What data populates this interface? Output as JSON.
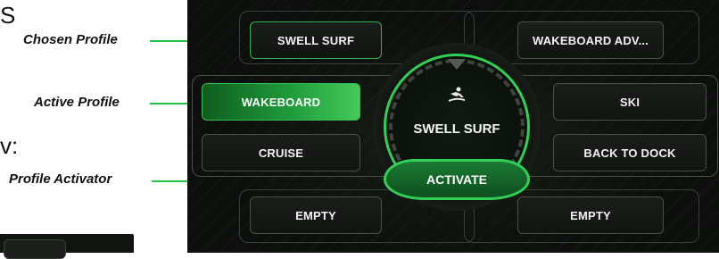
{
  "annotations": {
    "chosen_profile": "Chosen Profile",
    "active_profile": "Active Profile",
    "profile_activator": "Profile Activator"
  },
  "partial_text": {
    "top": "S",
    "middle": "v:"
  },
  "tiles": {
    "swell_surf": "SWELL SURF",
    "wakeboard_adv": "WAKEBOARD ADV...",
    "wakeboard": "WAKEBOARD",
    "ski": "SKI",
    "cruise": "CRUISE",
    "back_to_dock": "BACK TO DOCK",
    "empty_left": "EMPTY",
    "empty_right": "EMPTY"
  },
  "dial": {
    "icon": "surfer-icon",
    "profile_name": "SWELL SURF",
    "activate_label": "ACTIVATE"
  },
  "colors": {
    "accent_green": "#2fd055",
    "annotation_line": "#25c24a",
    "active_tile": "#1f9a3a",
    "screen_bg": "#0d0f0d"
  }
}
